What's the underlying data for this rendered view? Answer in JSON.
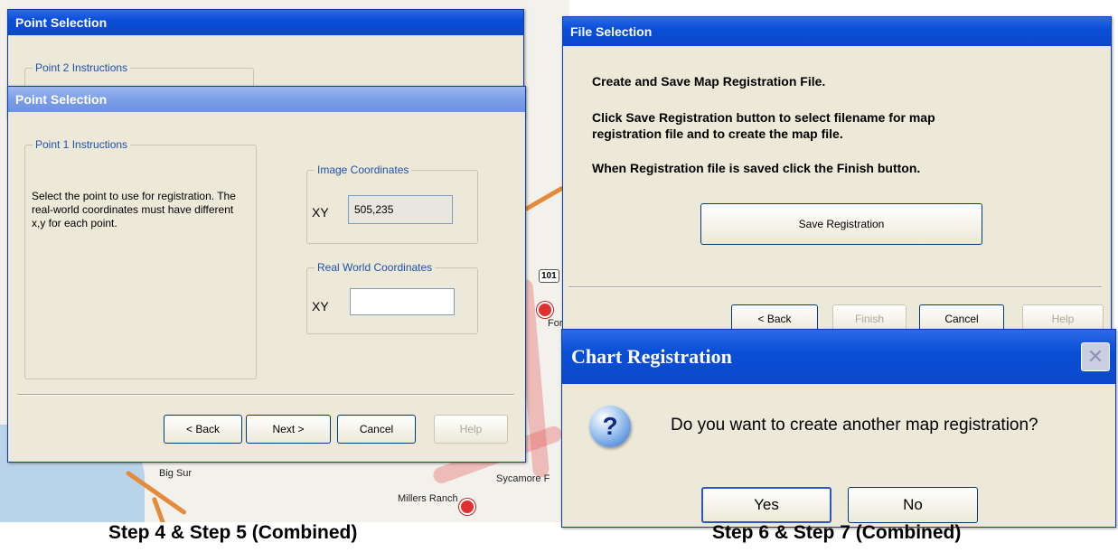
{
  "map": {
    "labels": [
      "Big Sur",
      "Millers Ranch",
      "Sycamore F"
    ],
    "highway": "101",
    "partial_label": "For"
  },
  "point2_window": {
    "title": "Point Selection",
    "group_title": "Point 2 Instructions"
  },
  "point1_window": {
    "title": "Point Selection",
    "instructions_group": "Point 1 Instructions",
    "instructions_text": "Select the point to use for registration. The real-world coordinates must have different x,y for each point.",
    "image_coords_group": "Image Coordinates",
    "image_xy_label": "XY",
    "image_xy_value": "505,235",
    "real_coords_group": "Real World Coordinates",
    "real_xy_label": "XY",
    "real_xy_value": "",
    "buttons": {
      "back": "< Back",
      "next": "Next >",
      "cancel": "Cancel",
      "help": "Help"
    }
  },
  "file_window": {
    "title": "File Selection",
    "line1": "Create and Save Map Registration File.",
    "line2": "Click Save Registration button to select filename for map registration file and to create the map file.",
    "line3": "When Registration file is saved click the Finish button.",
    "save_button": "Save Registration",
    "buttons": {
      "back": "< Back",
      "finish": "Finish",
      "cancel": "Cancel",
      "help": "Help"
    }
  },
  "chart_dialog": {
    "title": "Chart Registration",
    "question": "Do you want to create another map registration?",
    "yes": "Yes",
    "no": "No"
  },
  "captions": {
    "left": "Step 4 & Step 5 (Combined)",
    "right": "Step 6 & Step 7 (Combined)"
  }
}
